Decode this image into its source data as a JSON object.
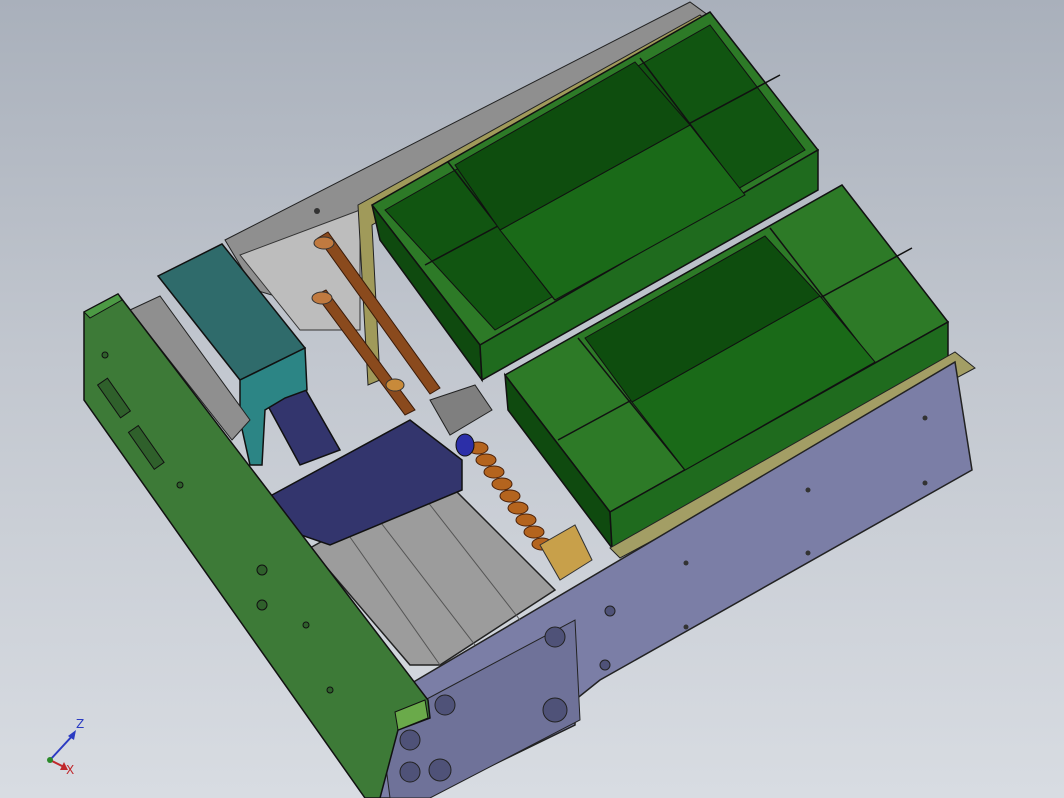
{
  "viewport": {
    "background_top": "#a9b0bb",
    "background_bottom": "#d8dce2"
  },
  "colors": {
    "tray_green": "#1f6b1e",
    "tray_green_dark": "#0f4a0f",
    "tray_green_light": "#3f8e33",
    "side_plate_green": "#3d7a37",
    "base_plate_purple": "#7b7ea6",
    "top_rail_gray": "#8d8d8d",
    "block_teal": "#2f6b6b",
    "motor_navy": "#33356d",
    "spring_brown": "#b4641e",
    "rod_brown": "#8a4a1d",
    "cylinder_gray": "#9c9c9c",
    "axis_x": "#c0282c",
    "axis_y": "#2a8a2a",
    "axis_z": "#2b3bc2"
  },
  "triad": {
    "icon": "xyz-axis-triad-icon",
    "z_label": "Z",
    "x_label": "X"
  }
}
